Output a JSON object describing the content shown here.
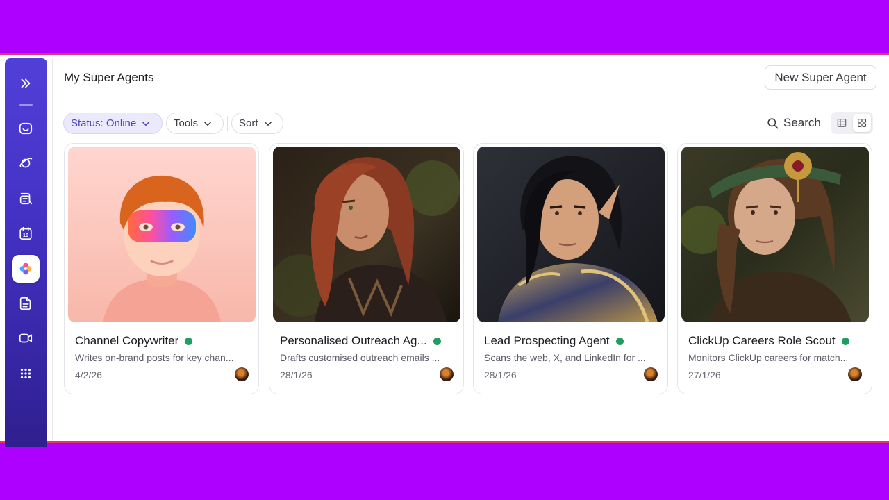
{
  "header": {
    "title": "My Super Agents",
    "new_button": "New Super Agent"
  },
  "filters": {
    "status": "Status: Online",
    "tools": "Tools",
    "sort": "Sort"
  },
  "search": {
    "label": "Search"
  },
  "view_toggle": {
    "active": "grid"
  },
  "sidebar": {
    "items": [
      {
        "icon": "expand-icon"
      },
      {
        "icon": "inbox-icon"
      },
      {
        "icon": "planet-icon"
      },
      {
        "icon": "chat-docs-icon"
      },
      {
        "icon": "calendar-icon",
        "text": "10"
      },
      {
        "icon": "ai-brain-icon",
        "active": true
      },
      {
        "icon": "document-icon"
      },
      {
        "icon": "video-icon"
      },
      {
        "icon": "apps-grid-icon"
      }
    ]
  },
  "agents": [
    {
      "name": "Channel Copywriter",
      "description": "Writes on-brand posts for key chan...",
      "date": "4/2/26",
      "status": "online"
    },
    {
      "name": "Personalised Outreach Ag...",
      "description": "Drafts customised outreach emails ...",
      "date": "28/1/26",
      "status": "online"
    },
    {
      "name": "Lead Prospecting Agent",
      "description": "Scans the web, X, and LinkedIn for ...",
      "date": "28/1/26",
      "status": "online"
    },
    {
      "name": "ClickUp Careers Role Scout",
      "description": "Monitors ClickUp careers for match...",
      "date": "27/1/26",
      "status": "online"
    }
  ],
  "colors": {
    "frame": "#ae00ff",
    "accent": "#4a3fc4",
    "online": "#1f9d63"
  }
}
